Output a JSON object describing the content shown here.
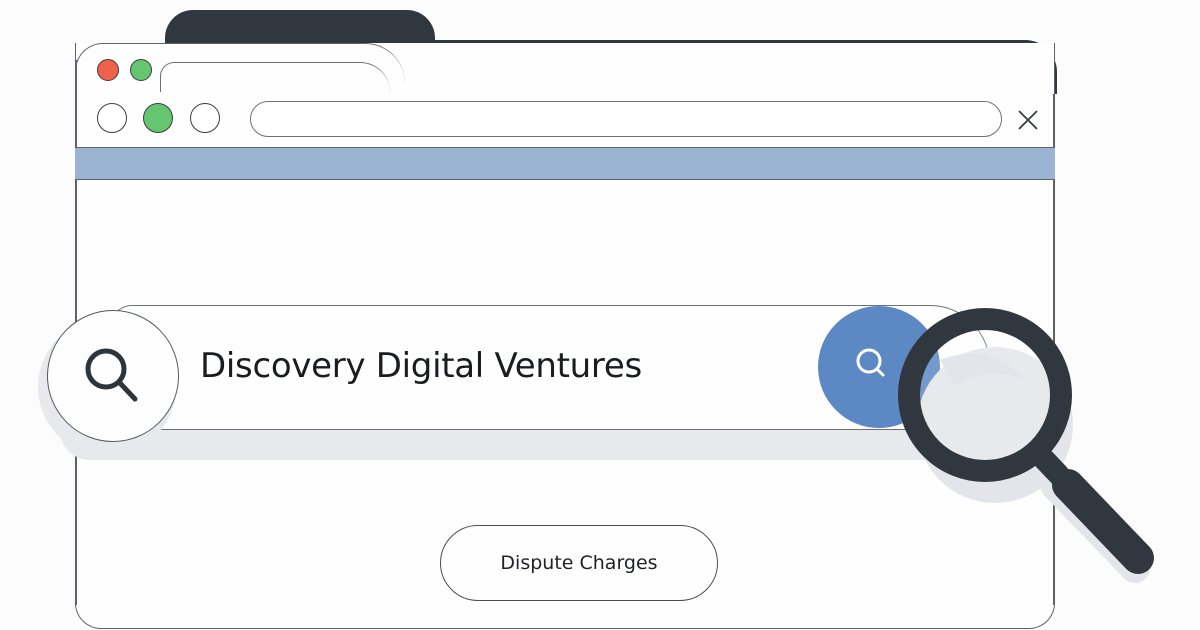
{
  "window": {
    "traffic_lights": [
      {
        "name": "close",
        "color": "#f0604a"
      },
      {
        "name": "maximize",
        "color": "#66c56f"
      }
    ],
    "nav_buttons": [
      {
        "name": "back",
        "color": "#ffffff"
      },
      {
        "name": "reload",
        "color": "#66c56f"
      },
      {
        "name": "forward",
        "color": "#ffffff"
      }
    ],
    "address_bar": {
      "value": "",
      "placeholder": ""
    },
    "close_icon": "close-x-icon",
    "band_color": "#9bb4d4",
    "chrome_color": "#31373e"
  },
  "search": {
    "query": "Discovery Digital Ventures",
    "left_icon": "search-icon",
    "button_icon": "search-icon",
    "button_color": "#5c88c3"
  },
  "decoration": {
    "magnifier_icon": "magnifying-glass-icon"
  },
  "actions": {
    "dispute_label": "Dispute Charges"
  }
}
